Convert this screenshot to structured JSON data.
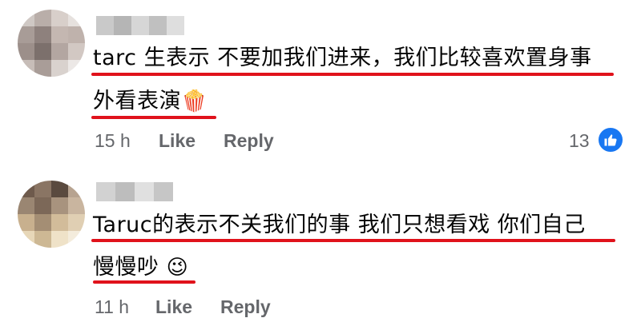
{
  "comments": [
    {
      "line1": "tarc 生表示 不要加我们进来，我们比较喜欢置身事",
      "line2": "外看表演",
      "emoji": "🍿",
      "emoji_name": "popcorn",
      "time": "15 h",
      "like_label": "Like",
      "reply_label": "Reply",
      "reaction_count": "13",
      "reaction_icon": "thumbs-up-icon"
    },
    {
      "line1": "Taruc的表示不关我们的事 我们只想看戏 你们自己",
      "line2": "慢慢吵",
      "emoji": "😉",
      "emoji_name": "winking-face",
      "time": "11 h",
      "like_label": "Like",
      "reply_label": "Reply"
    }
  ],
  "colors": {
    "underline": "#e0121b",
    "meta": "#65676b",
    "like_badge": "#1877f2"
  }
}
